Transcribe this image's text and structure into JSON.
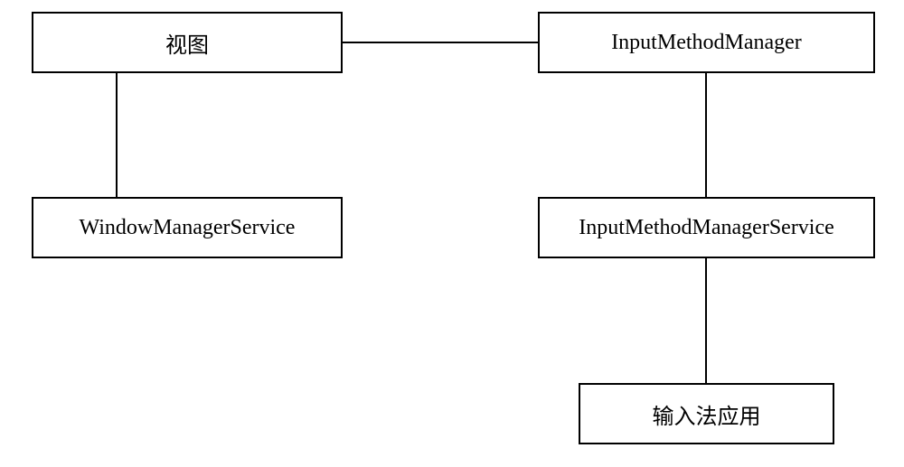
{
  "boxes": {
    "view": "视图",
    "imm": "InputMethodManager",
    "wms": "WindowManagerService",
    "imms": "InputMethodManagerService",
    "ime_app": "输入法应用"
  }
}
